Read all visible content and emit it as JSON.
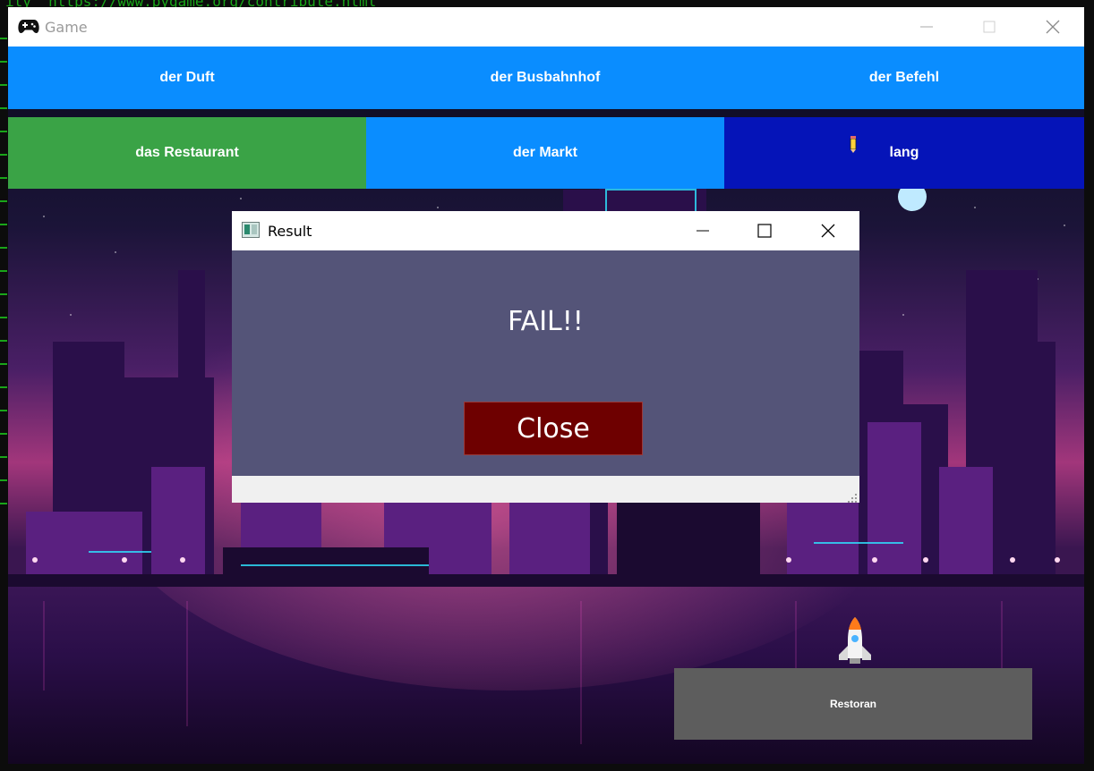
{
  "terminal": {
    "text": "ity  https://www.pygame.org/contribute.html"
  },
  "window": {
    "title": "Game",
    "icon": "gamepad-icon"
  },
  "tiles": [
    {
      "label": "der Duft",
      "color": "#0a8dff"
    },
    {
      "label": "der Busbahnhof",
      "color": "#0a8dff"
    },
    {
      "label": "der Befehl",
      "color": "#0a8dff"
    },
    {
      "label": "das Restaurant",
      "color": "#3aa346"
    },
    {
      "label": "der Markt",
      "color": "#0a8dff"
    },
    {
      "label": "lang",
      "color": "#0514b8"
    }
  ],
  "bottom_option": {
    "label": "Restoran",
    "color": "#5d5d5d"
  },
  "dialog": {
    "title": "Result",
    "message": "FAIL!!",
    "button_label": "Close",
    "button_color": "#6e0000",
    "background": "#545478"
  }
}
